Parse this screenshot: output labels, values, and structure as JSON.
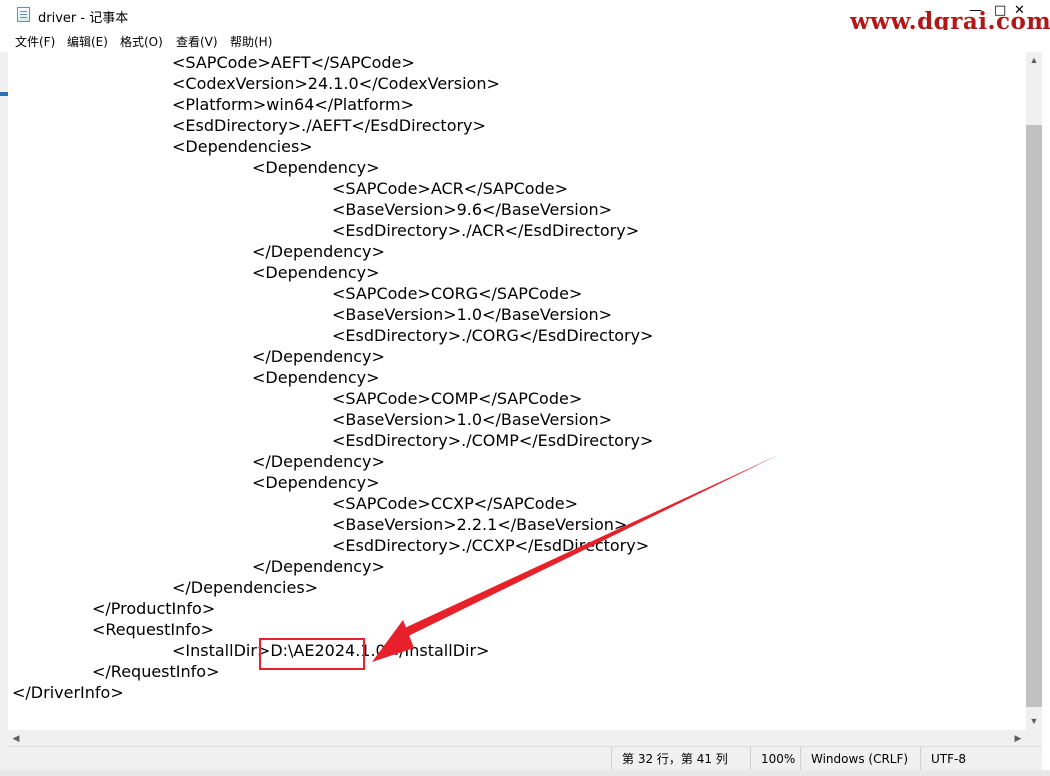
{
  "window": {
    "title": "driver - 记事本",
    "minimize": "—",
    "maximize": "□",
    "close": "✕"
  },
  "watermark": "www.dgrai.com",
  "menu": [
    "文件(F)",
    "编辑(E)",
    "格式(O)",
    "查看(V)",
    "帮助(H)"
  ],
  "lines": [
    {
      "indent": 2,
      "text": "<SAPCode>AEFT</SAPCode>"
    },
    {
      "indent": 2,
      "text": "<CodexVersion>24.1.0</CodexVersion>"
    },
    {
      "indent": 2,
      "text": "<Platform>win64</Platform>"
    },
    {
      "indent": 2,
      "text": "<EsdDirectory>./AEFT</EsdDirectory>"
    },
    {
      "indent": 2,
      "text": "<Dependencies>"
    },
    {
      "indent": 3,
      "text": "<Dependency>"
    },
    {
      "indent": 4,
      "text": "<SAPCode>ACR</SAPCode>"
    },
    {
      "indent": 4,
      "text": "<BaseVersion>9.6</BaseVersion>"
    },
    {
      "indent": 4,
      "text": "<EsdDirectory>./ACR</EsdDirectory>"
    },
    {
      "indent": 3,
      "text": "</Dependency>"
    },
    {
      "indent": 3,
      "text": "<Dependency>"
    },
    {
      "indent": 4,
      "text": "<SAPCode>CORG</SAPCode>"
    },
    {
      "indent": 4,
      "text": "<BaseVersion>1.0</BaseVersion>"
    },
    {
      "indent": 4,
      "text": "<EsdDirectory>./CORG</EsdDirectory>"
    },
    {
      "indent": 3,
      "text": "</Dependency>"
    },
    {
      "indent": 3,
      "text": "<Dependency>"
    },
    {
      "indent": 4,
      "text": "<SAPCode>COMP</SAPCode>"
    },
    {
      "indent": 4,
      "text": "<BaseVersion>1.0</BaseVersion>"
    },
    {
      "indent": 4,
      "text": "<EsdDirectory>./COMP</EsdDirectory>"
    },
    {
      "indent": 3,
      "text": "</Dependency>"
    },
    {
      "indent": 3,
      "text": "<Dependency>"
    },
    {
      "indent": 4,
      "text": "<SAPCode>CCXP</SAPCode>"
    },
    {
      "indent": 4,
      "text": "<BaseVersion>2.2.1</BaseVersion>"
    },
    {
      "indent": 4,
      "text": "<EsdDirectory>./CCXP</EsdDirectory>"
    },
    {
      "indent": 3,
      "text": "</Dependency>"
    },
    {
      "indent": 2,
      "text": "</Dependencies>"
    },
    {
      "indent": 1,
      "text": "</ProductInfo>"
    },
    {
      "indent": 1,
      "text": "<RequestInfo>"
    },
    {
      "indent": 2,
      "text": "<InstallDir>D:\\AE2024.1.0</InstallDir>"
    },
    {
      "indent": 1,
      "text": "</RequestInfo>"
    },
    {
      "indent": 0,
      "text": "</DriverInfo>"
    }
  ],
  "status": {
    "position": "第 32 行，第 41 列",
    "zoom": "100%",
    "line_ending": "Windows (CRLF)",
    "encoding": "UTF-8"
  },
  "annotation_color": "#e8202a"
}
